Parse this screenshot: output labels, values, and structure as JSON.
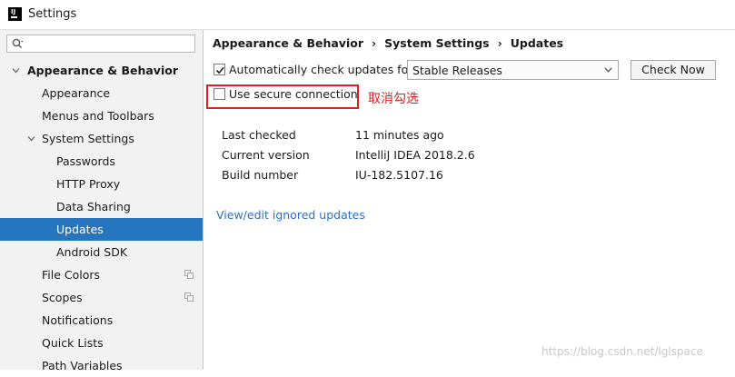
{
  "window": {
    "title": "Settings",
    "app_icon": "intellij-idea-icon"
  },
  "sidebar": {
    "search": {
      "value": "",
      "placeholder": ""
    },
    "items": [
      {
        "label": "Appearance & Behavior",
        "level": 0,
        "expanded": true
      },
      {
        "label": "Appearance",
        "level": 1
      },
      {
        "label": "Menus and Toolbars",
        "level": 1
      },
      {
        "label": "System Settings",
        "level": 1,
        "expanded": true
      },
      {
        "label": "Passwords",
        "level": 2
      },
      {
        "label": "HTTP Proxy",
        "level": 2
      },
      {
        "label": "Data Sharing",
        "level": 2
      },
      {
        "label": "Updates",
        "level": 2,
        "selected": true
      },
      {
        "label": "Android SDK",
        "level": 2
      },
      {
        "label": "File Colors",
        "level": 1,
        "icon": "copy-icon"
      },
      {
        "label": "Scopes",
        "level": 1,
        "icon": "copy-icon"
      },
      {
        "label": "Notifications",
        "level": 1
      },
      {
        "label": "Quick Lists",
        "level": 1
      },
      {
        "label": "Path Variables",
        "level": 1
      }
    ]
  },
  "breadcrumb": [
    "Appearance & Behavior",
    "System Settings",
    "Updates"
  ],
  "auto_check": {
    "label": "Automatically check updates for",
    "checked": true,
    "channel": "Stable Releases"
  },
  "check_now_label": "Check Now",
  "secure_connection": {
    "label": "Use secure connection",
    "checked": false
  },
  "annotation": "取消勾选",
  "info": {
    "last_checked_label": "Last checked",
    "last_checked_value": "11 minutes ago",
    "current_version_label": "Current version",
    "current_version_value": "IntelliJ IDEA 2018.2.6",
    "build_number_label": "Build number",
    "build_number_value": "IU-182.5107.16"
  },
  "ignored_link": "View/edit ignored updates",
  "watermark": "https://blog.csdn.net/lglspace",
  "colors": {
    "selection": "#2675bf",
    "annotation": "#e01f1f",
    "link": "#2d6ec4"
  }
}
